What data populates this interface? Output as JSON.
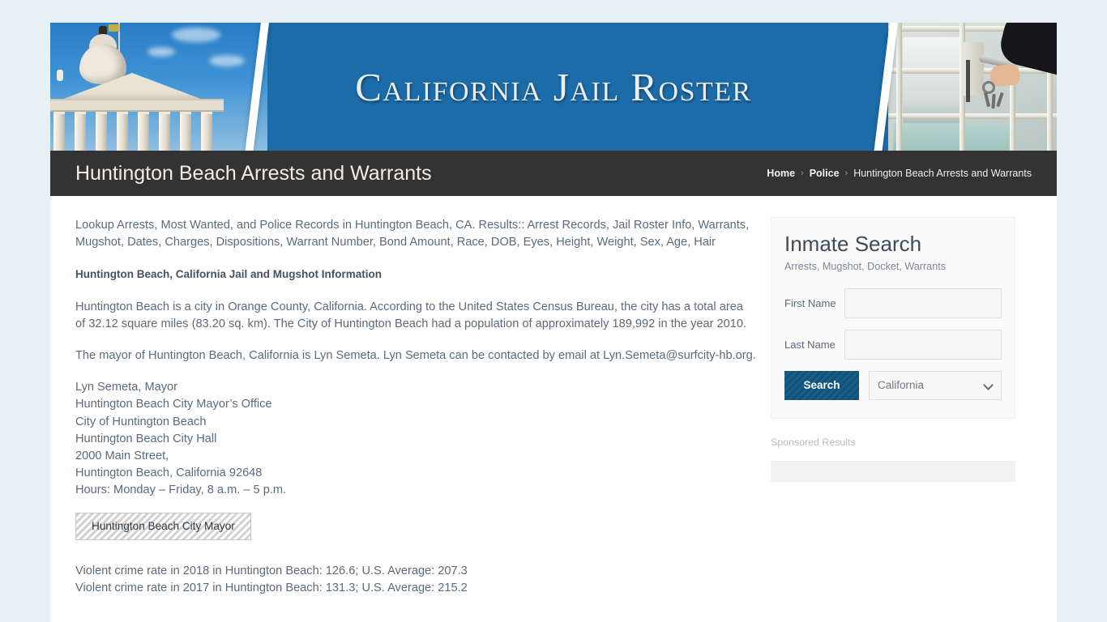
{
  "site": {
    "banner_title": "California Jail Roster",
    "banner_color": "#1c6caa",
    "page_bg_color": "#e7f0f5",
    "left_photo": "capitol-building-photo",
    "right_photo": "jail-cell-door-hand-keys-photo"
  },
  "titlebar": {
    "page_title": "Huntington Beach Arrests and Warrants",
    "bar_color": "#333333",
    "breadcrumb": {
      "home": "Home",
      "separator": "›",
      "police": "Police",
      "current": "Huntington Beach Arrests and Warrants"
    }
  },
  "main": {
    "intro": "Lookup Arrests, Most Wanted, and Police Records in Huntington Beach, CA. Results:: Arrest Records, Jail Roster Info, Warrants, Mugshot, Dates, Charges, Dispositions, Warrant Number, Bond Amount, Race, DOB, Eyes, Height, Weight, Sex, Age, Hair",
    "subheading": "Huntington Beach, California Jail and Mugshot Information",
    "city_paragraph": "Huntington Beach is a city in Orange County, California. According to the United States Census Bureau, the city has a total area of 32.12 square miles (83.20 sq. km). The City of Huntington Beach had a population of approximately 189,992 in the year 2010.",
    "mayor_paragraph": "The mayor of Huntington Beach, California is Lyn Semeta. Lyn Semeta can be contacted by email at Lyn.Semeta@surfcity-hb.org.",
    "address_lines": [
      "Lyn Semeta, Mayor",
      "Huntington Beach City Mayor’s Office",
      "City of Huntington Beach",
      "Huntington Beach City Hall",
      "2000 Main Street,",
      "Huntington Beach, California 92648",
      "Hours: Monday – Friday, 8 a.m. – 5 p.m."
    ],
    "mayor_button": "Huntington Beach City Mayor",
    "crime_lines": [
      "Violent crime rate in 2018 in Huntington Beach: 126.6; U.S. Average: 207.3",
      "Violent crime rate in 2017 in Huntington Beach: 131.3; U.S. Average: 215.2"
    ]
  },
  "sidebar": {
    "title": "Inmate Search",
    "subtitle": "Arrests, Mugshot, Docket, Warrants",
    "first_name_label": "First Name",
    "first_name_value": "",
    "first_name_placeholder": "",
    "last_name_label": "Last Name",
    "last_name_value": "",
    "last_name_placeholder": "",
    "search_button": "Search",
    "search_button_color": "#11557f",
    "state_selected": "California",
    "sponsored_label": "Sponsored Results"
  }
}
